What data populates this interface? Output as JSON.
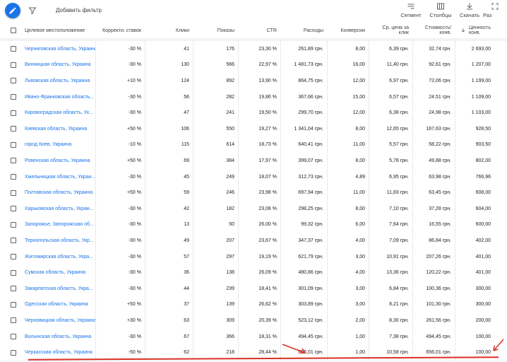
{
  "toolbar": {
    "add_filter": "Добавить фильтр",
    "segment": "Сегмент",
    "columns": "Столбцы",
    "download": "Скачать",
    "more": "Раз"
  },
  "columns": {
    "location": "Целевое местоположение",
    "bid_adj": "Корректи. ставок",
    "clicks": "Клики",
    "impr": "Показы",
    "ctr": "CTR",
    "cost": "Расходы",
    "conv": "Конверсии",
    "avg_cpc_1": "Ср. цена за",
    "avg_cpc_2": "клик",
    "cost_conv_1": "Стоимость/",
    "cost_conv_2": "конв.",
    "value_conv_1": "Ценность",
    "value_conv_2": "конв."
  },
  "rows": [
    {
      "loc": "Черниговская область, Украина",
      "adj": "-30 %",
      "clicks": "41",
      "impr": "176",
      "ctr": "23,30 %",
      "cost": "261,89 грн.",
      "conv": "8,00",
      "cpc": "6,39 грн.",
      "cpa": "32,74 грн.",
      "val": "2 693,00"
    },
    {
      "loc": "Винницкая область, Украина",
      "adj": "-30 %",
      "clicks": "130",
      "impr": "566",
      "ctr": "22,97 %",
      "cost": "1 481,73 грн.",
      "conv": "16,00",
      "cpc": "11,40 грн.",
      "cpa": "92,61 грн.",
      "val": "1 207,00"
    },
    {
      "loc": "Львовская область, Украина",
      "adj": "+10 %",
      "clicks": "124",
      "impr": "892",
      "ctr": "13,90 %",
      "cost": "864,75 грн.",
      "conv": "12,00",
      "cpc": "6,97 грн.",
      "cpa": "72,06 грн.",
      "val": "1 199,00"
    },
    {
      "loc": "Ивано-Франковская область...",
      "adj": "-30 %",
      "clicks": "56",
      "impr": "282",
      "ctr": "19,86 %",
      "cost": "367,66 грн.",
      "conv": "15,00",
      "cpc": "6,57 грн.",
      "cpa": "24,51 грн.",
      "val": "1 109,00"
    },
    {
      "loc": "Кировоградская область, Ук...",
      "adj": "-30 %",
      "clicks": "47",
      "impr": "241",
      "ctr": "19,50 %",
      "cost": "299,70 грн.",
      "conv": "12,00",
      "cpc": "6,38 грн.",
      "cpa": "24,98 грн.",
      "val": "1 103,00"
    },
    {
      "loc": "Киевская область, Украина",
      "adj": "+50 %",
      "clicks": "106",
      "impr": "550",
      "ctr": "19,27 %",
      "cost": "1 341,04 грн.",
      "conv": "8,00",
      "cpc": "12,65 грн.",
      "cpa": "167,63 грн.",
      "val": "928,50"
    },
    {
      "loc": "город Киев, Украина",
      "adj": "-10 %",
      "clicks": "115",
      "impr": "614",
      "ctr": "18,73 %",
      "cost": "640,41 грн.",
      "conv": "11,00",
      "cpc": "5,57 грн.",
      "cpa": "58,22 грн.",
      "val": "903,50"
    },
    {
      "loc": "Ровенская область, Украина",
      "adj": "+50 %",
      "clicks": "69",
      "impr": "384",
      "ctr": "17,97 %",
      "cost": "399,07 грн.",
      "conv": "8,00",
      "cpc": "5,78 грн.",
      "cpa": "49,88 грн.",
      "val": "802,00"
    },
    {
      "loc": "Хмельницкая область, Украи...",
      "adj": "-30 %",
      "clicks": "45",
      "impr": "249",
      "ctr": "18,07 %",
      "cost": "312,73 грн.",
      "conv": "4,89",
      "cpc": "6,95 грн.",
      "cpa": "63,98 грн.",
      "val": "766,96"
    },
    {
      "loc": "Полтавская область, Украина",
      "adj": "+50 %",
      "clicks": "59",
      "impr": "246",
      "ctr": "23,98 %",
      "cost": "697,94 грн.",
      "conv": "11,00",
      "cpc": "11,83 грн.",
      "cpa": "63,45 грн.",
      "val": "608,00"
    },
    {
      "loc": "Харьковская область, Украи...",
      "adj": "-30 %",
      "clicks": "42",
      "impr": "182",
      "ctr": "23,08 %",
      "cost": "298,25 грн.",
      "conv": "8,00",
      "cpc": "7,10 грн.",
      "cpa": "37,28 грн.",
      "val": "604,00"
    },
    {
      "loc": "Запорожье, Запорожская об...",
      "adj": "-30 %",
      "clicks": "13",
      "impr": "50",
      "ctr": "26,00 %",
      "cost": "99,32 грн.",
      "conv": "6,00",
      "cpc": "7,64 грн.",
      "cpa": "16,55 грн.",
      "val": "600,00"
    },
    {
      "loc": "Тернопольская область, Укр...",
      "adj": "-30 %",
      "clicks": "49",
      "impr": "207",
      "ctr": "23,67 %",
      "cost": "347,37 грн.",
      "conv": "4,00",
      "cpc": "7,09 грн.",
      "cpa": "86,84 грн.",
      "val": "402,00"
    },
    {
      "loc": "Житомирская область, Укра...",
      "adj": "-30 %",
      "clicks": "57",
      "impr": "297",
      "ctr": "19,19 %",
      "cost": "621,79 грн.",
      "conv": "3,00",
      "cpc": "10,91 грн.",
      "cpa": "207,26 грн.",
      "val": "401,00"
    },
    {
      "loc": "Сумская область, Украина",
      "adj": "-30 %",
      "clicks": "36",
      "impr": "138",
      "ctr": "26,09 %",
      "cost": "480,86 грн.",
      "conv": "4,00",
      "cpc": "13,36 грн.",
      "cpa": "120,22 грн.",
      "val": "401,00"
    },
    {
      "loc": "Закарпатская область, Укра...",
      "adj": "-30 %",
      "clicks": "44",
      "impr": "239",
      "ctr": "18,41 %",
      "cost": "301,09 грн.",
      "conv": "3,00",
      "cpc": "6,84 грн.",
      "cpa": "100,36 грн.",
      "val": "300,00"
    },
    {
      "loc": "Одесская область, Украина",
      "adj": "+50 %",
      "clicks": "37",
      "impr": "139",
      "ctr": "26,62 %",
      "cost": "303,89 грн.",
      "conv": "3,00",
      "cpc": "8,21 грн.",
      "cpa": "101,30 грн.",
      "val": "300,00"
    },
    {
      "loc": "Черновицкая область, Украина",
      "adj": "+30 %",
      "clicks": "63",
      "impr": "309",
      "ctr": "20,39 %",
      "cost": "523,12 грн.",
      "conv": "2,00",
      "cpc": "8,30 грн.",
      "cpa": "261,56 грн.",
      "val": "200,00"
    },
    {
      "loc": "Волынская область, Украина",
      "adj": "-30 %",
      "clicks": "67",
      "impr": "366",
      "ctr": "18,31 %",
      "cost": "494,45 грн.",
      "conv": "1,00",
      "cpc": "7,38 грн.",
      "cpa": "494,45 грн.",
      "val": "100,00"
    },
    {
      "loc": "Черкасская область, Украина",
      "adj": "-50 %",
      "clicks": "62",
      "impr": "218",
      "ctr": "28,44 %",
      "cost": "656,01 грн.",
      "conv": "1,00",
      "cpc": "10,58 грн.",
      "cpa": "656,01 грн.",
      "val": "100,00"
    }
  ],
  "colors": {
    "accent": "#1a73e8",
    "annotation": "#d93025"
  }
}
